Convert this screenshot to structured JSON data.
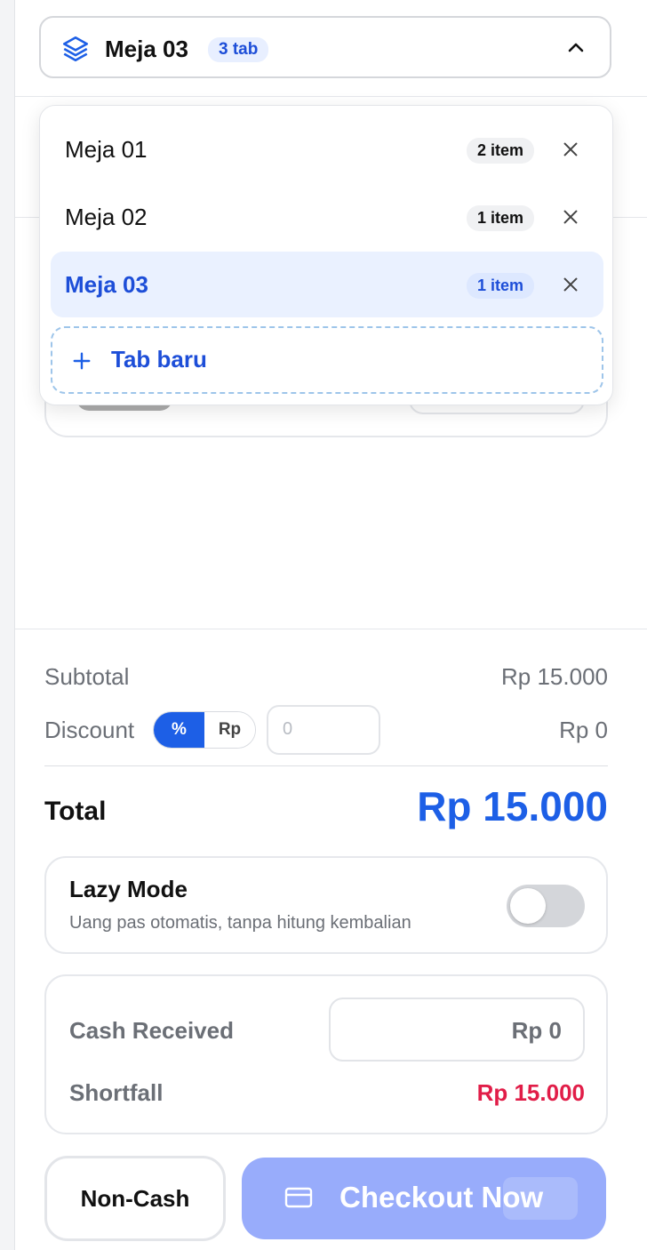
{
  "tab_selector": {
    "title": "Meja 03",
    "count_label": "3 tab"
  },
  "dropdown": {
    "tabs": [
      {
        "name": "Meja 01",
        "badge": "2 item"
      },
      {
        "name": "Meja 02",
        "badge": "1 item"
      },
      {
        "name": "Meja 03",
        "badge": "1 item"
      }
    ],
    "new_tab_label": "Tab baru"
  },
  "summary": {
    "subtotal_label": "Subtotal",
    "subtotal_value": "Rp 15.000",
    "discount_label": "Discount",
    "discount_percent": "%",
    "discount_rp": "Rp",
    "discount_input_value": "0",
    "discount_value": "Rp 0",
    "total_label": "Total",
    "total_value": "Rp 15.000"
  },
  "lazy_mode": {
    "title": "Lazy Mode",
    "subtitle": "Uang pas otomatis, tanpa hitung kembalian",
    "enabled": false
  },
  "cash": {
    "received_label": "Cash Received",
    "received_value": "Rp 0",
    "shortfall_label": "Shortfall",
    "shortfall_value": "Rp 15.000"
  },
  "actions": {
    "noncash_label": "Non-Cash",
    "checkout_label": "Checkout Now"
  },
  "colors": {
    "primary": "#1d5fe6",
    "danger": "#e11d48",
    "checkout_bg": "#98acfb"
  }
}
